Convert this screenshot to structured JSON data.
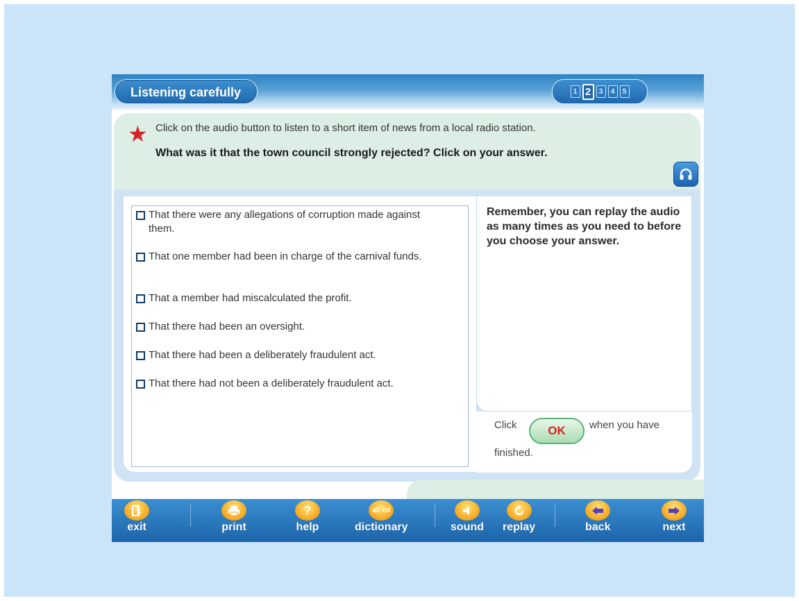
{
  "header": {
    "title": "Listening carefully",
    "pages": [
      "1",
      "2",
      "3",
      "4",
      "5"
    ],
    "current_page": "2"
  },
  "instruction": {
    "text": "Click on the audio button to listen to a short item of news from a local radio station.",
    "question": "What was it that the town council strongly rejected? Click on your answer."
  },
  "answers": [
    "That there were any allegations of corruption made against them.",
    "That one member had been in charge of the carnival funds.",
    "That a member had miscalculated the profit.",
    "That there had been an oversight.",
    "That there had been a deliberately fraudulent act.",
    "That there had not been a deliberately fraudulent act."
  ],
  "tip": {
    "text": "Remember, you can replay the audio as many times as you need to before you choose your answer."
  },
  "finish": {
    "click": "Click",
    "ok": "OK",
    "when": "when you have",
    "finished": "finished."
  },
  "toolbar": {
    "exit": "exit",
    "print": "print",
    "help": "help",
    "dictionary": "dictionary",
    "dictionary_icon": "ab cd",
    "help_icon": "?",
    "sound": "sound",
    "replay": "replay",
    "back": "back",
    "next": "next"
  },
  "colors": {
    "page_bg": "#cce4f7",
    "header_blue": "#1f68ae",
    "instruction_bg": "#ddeee5",
    "star_red": "#d4262a",
    "tool_orange": "#f7a61c",
    "ok_text": "#d8201e"
  }
}
